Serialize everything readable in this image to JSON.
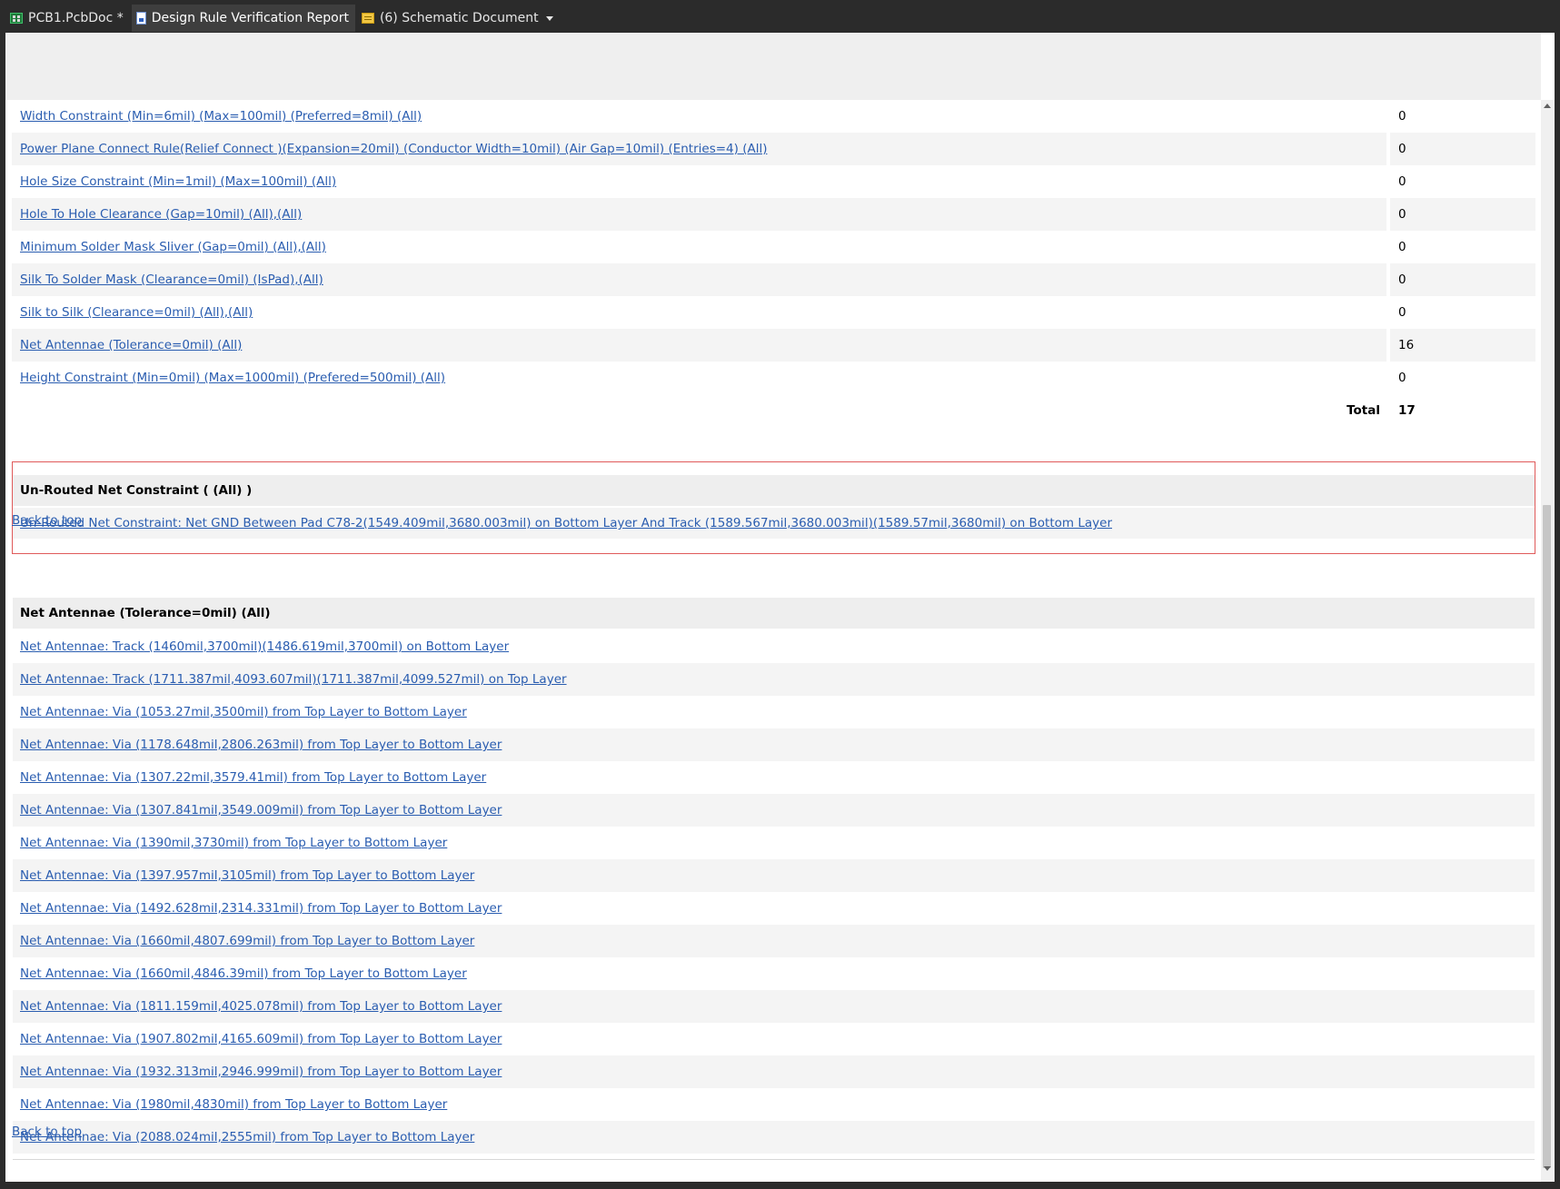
{
  "tabs": [
    {
      "label": "PCB1.PcbDoc *",
      "icon": "pcb-doc-icon"
    },
    {
      "label": "Design Rule Verification Report",
      "icon": "report-icon"
    },
    {
      "label": "(6) Schematic Document",
      "icon": "schematic-doc-icon"
    }
  ],
  "summary": {
    "rows": [
      {
        "rule": "Width Constraint (Min=6mil) (Max=100mil) (Preferred=8mil) (All)",
        "count": "0"
      },
      {
        "rule": "Power Plane Connect Rule(Relief Connect )(Expansion=20mil) (Conductor Width=10mil) (Air Gap=10mil) (Entries=4) (All)",
        "count": "0"
      },
      {
        "rule": "Hole Size Constraint (Min=1mil) (Max=100mil) (All)",
        "count": "0"
      },
      {
        "rule": "Hole To Hole Clearance (Gap=10mil) (All),(All)",
        "count": "0"
      },
      {
        "rule": "Minimum Solder Mask Sliver (Gap=0mil) (All),(All)",
        "count": "0"
      },
      {
        "rule": "Silk To Solder Mask (Clearance=0mil) (IsPad),(All)",
        "count": "0"
      },
      {
        "rule": "Silk to Silk (Clearance=0mil) (All),(All)",
        "count": "0"
      },
      {
        "rule": "Net Antennae (Tolerance=0mil) (All)",
        "count": "16"
      },
      {
        "rule": "Height Constraint (Min=0mil) (Max=1000mil) (Prefered=500mil) (All)",
        "count": "0"
      }
    ],
    "total_label": "Total",
    "total_value": "17"
  },
  "unrouted": {
    "heading": "Un-Routed Net Constraint ( (All) )",
    "item": "Un-Routed Net Constraint: Net GND Between Pad C78-2(1549.409mil,3680.003mil) on Bottom Layer And Track (1589.567mil,3680.003mil)(1589.57mil,3680mil) on Bottom Layer "
  },
  "back_to_top": "Back to top",
  "antennae": {
    "heading": "Net Antennae (Tolerance=0mil) (All)",
    "items": [
      "Net Antennae: Track (1460mil,3700mil)(1486.619mil,3700mil) on Bottom Layer ",
      "Net Antennae: Track (1711.387mil,4093.607mil)(1711.387mil,4099.527mil) on Top Layer ",
      "Net Antennae: Via (1053.27mil,3500mil) from Top Layer to Bottom Layer ",
      "Net Antennae: Via (1178.648mil,2806.263mil) from Top Layer to Bottom Layer ",
      "Net Antennae: Via (1307.22mil,3579.41mil) from Top Layer to Bottom Layer ",
      "Net Antennae: Via (1307.841mil,3549.009mil) from Top Layer to Bottom Layer ",
      "Net Antennae: Via (1390mil,3730mil) from Top Layer to Bottom Layer ",
      "Net Antennae: Via (1397.957mil,3105mil) from Top Layer to Bottom Layer ",
      "Net Antennae: Via (1492.628mil,2314.331mil) from Top Layer to Bottom Layer ",
      "Net Antennae: Via (1660mil,4807.699mil) from Top Layer to Bottom Layer ",
      "Net Antennae: Via (1660mil,4846.39mil) from Top Layer to Bottom Layer ",
      "Net Antennae: Via (1811.159mil,4025.078mil) from Top Layer to Bottom Layer ",
      "Net Antennae: Via (1907.802mil,4165.609mil) from Top Layer to Bottom Layer ",
      "Net Antennae: Via (1932.313mil,2946.999mil) from Top Layer to Bottom Layer ",
      "Net Antennae: Via (1980mil,4830mil) from Top Layer to Bottom Layer ",
      "Net Antennae: Via (2088.024mil,2555mil) from Top Layer to Bottom Layer "
    ]
  },
  "colors": {
    "link": "#2a5db0",
    "highlight_border": "#e05a5a",
    "tabbar_bg": "#2b2b2b"
  }
}
